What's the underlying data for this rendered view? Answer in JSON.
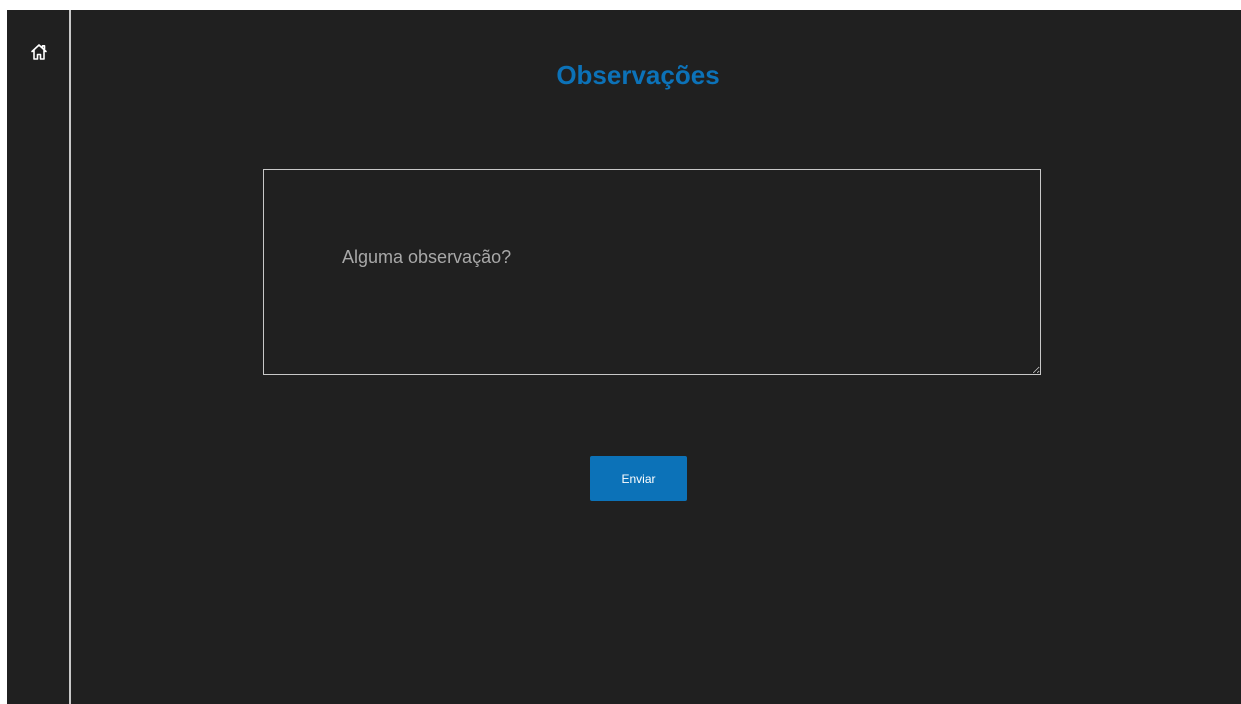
{
  "sidebar": {
    "home_icon": "home-icon"
  },
  "main": {
    "title": "Observações",
    "observation": {
      "value": "",
      "placeholder": "Alguma observação?"
    },
    "submit_label": "Enviar"
  },
  "colors": {
    "background": "#202020",
    "accent": "#0c72b8",
    "border": "#c8c8c8",
    "placeholder": "#a8a8a8"
  }
}
